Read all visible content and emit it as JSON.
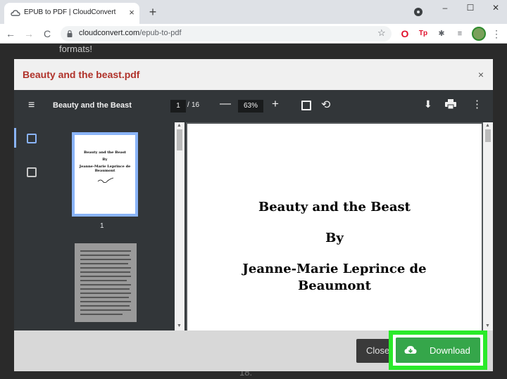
{
  "browser": {
    "tab_title": "EPUB to PDF | CloudConvert",
    "tab_close": "×",
    "new_tab": "+",
    "window_controls": [
      "–",
      "☐",
      "✕"
    ],
    "nav": {
      "back": "←",
      "forward": "→",
      "reload": "C"
    },
    "url_host": "cloudconvert.com",
    "url_path": "/epub-to-pdf",
    "bookmark_star": "☆",
    "extensions": {
      "opera": "O",
      "tp": "Tp",
      "puzzle": "✱",
      "media": "≡",
      "menu": "⋮"
    }
  },
  "page": {
    "behind_text": "formats!",
    "bottom_text": "18."
  },
  "modal": {
    "title": "Beauty and the beast.pdf",
    "close": "×",
    "viewer": {
      "menu_icon": "≡",
      "doc_title": "Beauty and the Beast",
      "current_page": "1",
      "page_sep": "/",
      "total_pages": "16",
      "zoom_out": "—",
      "zoom": "63%",
      "zoom_in": "+",
      "rotate": "⟲",
      "download": "⬇",
      "more": "⋮",
      "thumbnail_number": "1",
      "thumbnail_lines": [
        "Beauty and the Beast",
        "By",
        "Jeanne-Marie Leprince de",
        "Beaumont"
      ],
      "page_lines": [
        "Beauty and the Beast",
        "By",
        "Jeanne-Marie Leprince de",
        "Beaumont"
      ]
    },
    "footer": {
      "close_label": "Close",
      "download_label": "Download"
    }
  },
  "colors": {
    "title_red": "#b0322a",
    "download_green": "#35a64a",
    "highlight_green": "#2aea2a",
    "viewer_toolbar": "#323639"
  }
}
